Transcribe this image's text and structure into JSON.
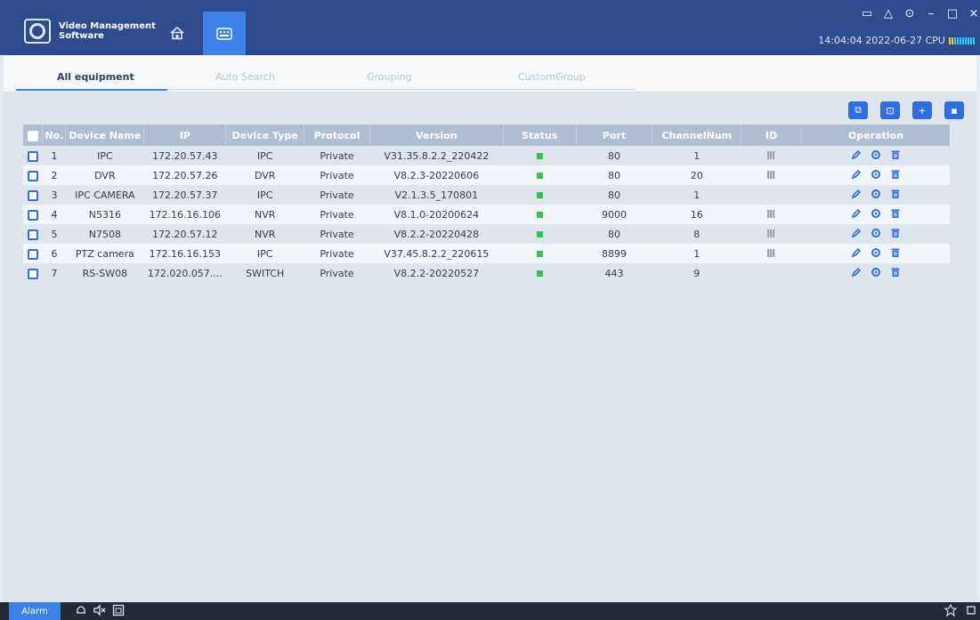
{
  "app": {
    "title_line1": "Video Management",
    "title_line2": "Software",
    "clock": "14:04:04 2022-06-27 CPU"
  },
  "tabs": [
    {
      "label": "All equipment",
      "active": true
    },
    {
      "label": "Auto Search",
      "active": false
    },
    {
      "label": "Grouping",
      "active": false
    },
    {
      "label": "CustomGroup",
      "active": false
    }
  ],
  "table": {
    "columns": [
      "No.",
      "Device Name",
      "IP",
      "Device Type",
      "Protocol",
      "Version",
      "Status",
      "Port",
      "ChannelNum",
      "ID",
      "Operation"
    ],
    "rows": [
      {
        "no": "1",
        "name": "IPC",
        "ip": "172.20.57.43",
        "type": "IPC",
        "protocol": "Private",
        "version": "V31.35.8.2.2_220422",
        "port": "80",
        "channels": "1",
        "has_id": true
      },
      {
        "no": "2",
        "name": "DVR",
        "ip": "172.20.57.26",
        "type": "DVR",
        "protocol": "Private",
        "version": "V8.2.3-20220606",
        "port": "80",
        "channels": "20",
        "has_id": true
      },
      {
        "no": "3",
        "name": "IPC CAMERA",
        "ip": "172.20.57.37",
        "type": "IPC",
        "protocol": "Private",
        "version": "V2.1.3.5_170801",
        "port": "80",
        "channels": "1",
        "has_id": false
      },
      {
        "no": "4",
        "name": "N5316",
        "ip": "172.16.16.106",
        "type": "NVR",
        "protocol": "Private",
        "version": "V8.1.0-20200624",
        "port": "9000",
        "channels": "16",
        "has_id": true
      },
      {
        "no": "5",
        "name": "N7508",
        "ip": "172.20.57.12",
        "type": "NVR",
        "protocol": "Private",
        "version": "V8.2.2-20220428",
        "port": "80",
        "channels": "8",
        "has_id": true
      },
      {
        "no": "6",
        "name": "PTZ camera",
        "ip": "172.16.16.153",
        "type": "IPC",
        "protocol": "Private",
        "version": "V37.45.8.2.2_220615",
        "port": "8899",
        "channels": "1",
        "has_id": true
      },
      {
        "no": "7",
        "name": "RS-SW08",
        "ip": "172.020.057....",
        "type": "SWITCH",
        "protocol": "Private",
        "version": "V8.2.2-20220527",
        "port": "443",
        "channels": "9",
        "has_id": false
      }
    ]
  },
  "statusbar": {
    "alarm_label": "Alarm"
  },
  "colors": {
    "titlebar": "#2f4a8f",
    "accent": "#3c82e8",
    "status_online": "#37c24a",
    "table_header": "#aebfd3"
  }
}
